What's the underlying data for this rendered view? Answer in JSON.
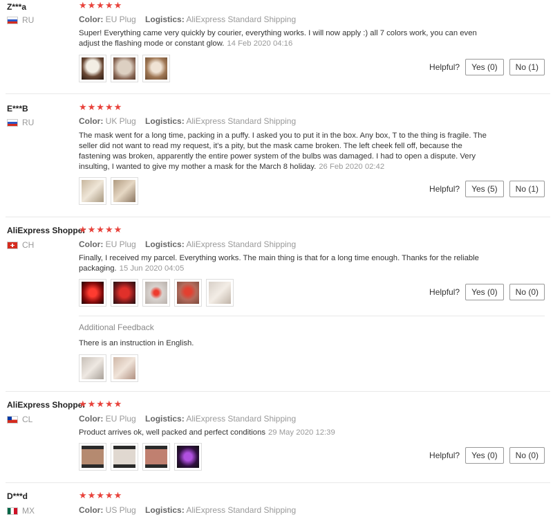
{
  "labels": {
    "color": "Color:",
    "logistics": "Logistics:",
    "helpful": "Helpful?",
    "additional": "Additional Feedback"
  },
  "reviews": [
    {
      "user": "Z***a",
      "country": "RU",
      "stars": "★★★★★",
      "color": "EU Plug",
      "logistics": "AliExpress Standard Shipping",
      "text": "Super! Everything came very quickly by courier, everything works. I will now apply :) all 7 colors work, you can even adjust the flashing mode or constant glow.",
      "date": "14 Feb 2020 04:16",
      "yes": "Yes (0)",
      "no": "No (1)"
    },
    {
      "user": "E***B",
      "country": "RU",
      "stars": "★★★★★",
      "color": "UK Plug",
      "logistics": "AliExpress Standard Shipping",
      "text": "The mask went for a long time, packing in a puffy. I asked you to put it in the box. Any box, T to the thing is fragile. The seller did not want to read my request, it's a pity, but the mask came broken. The left cheek fell off, because the fastening was broken, apparently the entire power system of the bulbs was damaged. I had to open a dispute. Very insulting, I wanted to give my mother a mask for the March 8 holiday.",
      "date": "26 Feb 2020 02:42",
      "yes": "Yes (5)",
      "no": "No (1)"
    },
    {
      "user": "AliExpress Shopper",
      "country": "CH",
      "stars": "★★★★★",
      "color": "EU Plug",
      "logistics": "AliExpress Standard Shipping",
      "text": "Finally, I received my parcel. Everything works. The main thing is that for a long time enough. Thanks for the reliable packaging.",
      "date": "15 Jun 2020 04:05",
      "yes": "Yes (0)",
      "no": "No (0)",
      "additional": "There is an instruction in English."
    },
    {
      "user": "AliExpress Shopper",
      "country": "CL",
      "stars": "★★★★★",
      "color": "EU Plug",
      "logistics": "AliExpress Standard Shipping",
      "text": "Product arrives ok, well packed and perfect conditions",
      "date": "29 May 2020 12:39",
      "yes": "Yes (0)",
      "no": "No (0)"
    },
    {
      "user": "D***d",
      "country": "MX",
      "stars": "★★★★★",
      "color": "US Plug",
      "logistics": "AliExpress Standard Shipping"
    }
  ],
  "colors": {
    "star": "#e8423b",
    "muted": "#999999"
  }
}
